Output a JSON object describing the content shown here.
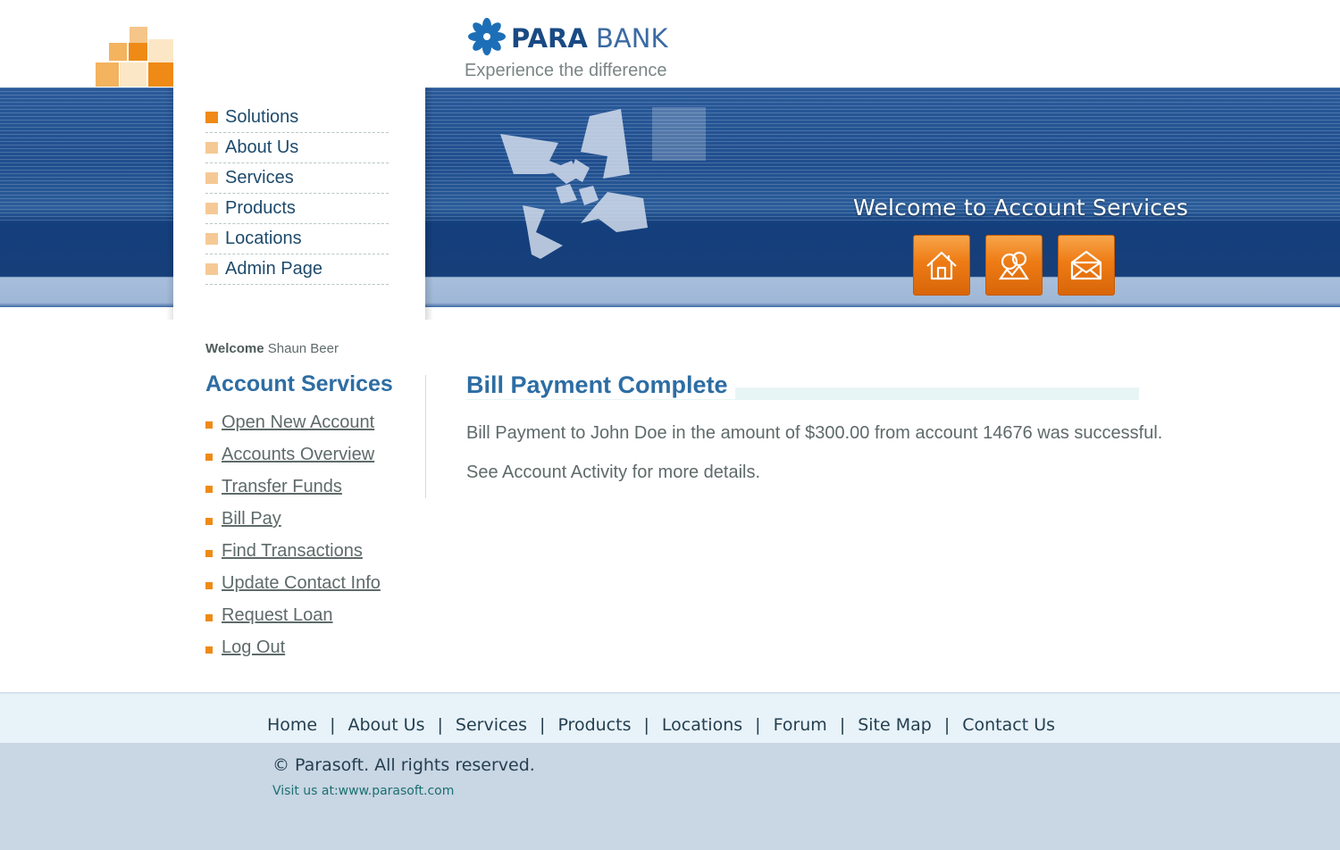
{
  "brand": {
    "name_bold": "PARA",
    "name_light": "BANK",
    "tagline": "Experience the difference"
  },
  "top_menu": [
    {
      "label": "Solutions",
      "active": true
    },
    {
      "label": "About Us"
    },
    {
      "label": "Services"
    },
    {
      "label": "Products"
    },
    {
      "label": "Locations"
    },
    {
      "label": "Admin Page"
    }
  ],
  "header": {
    "banner": "Welcome to Account Services",
    "buttons": [
      {
        "icon": "home-icon"
      },
      {
        "icon": "contact-people-icon"
      },
      {
        "icon": "envelope-icon"
      }
    ]
  },
  "account_panel": {
    "welcome_label": "Welcome",
    "user_name": "Shaun Beer",
    "title": "Account Services",
    "links": [
      "Open New Account",
      "Accounts Overview",
      "Transfer Funds",
      "Bill Pay",
      "Find Transactions",
      "Update Contact Info",
      "Request Loan",
      "Log Out"
    ]
  },
  "main": {
    "title": "Bill Payment Complete",
    "message": "Bill Payment to John Doe in the amount of $300.00 from account 14676 was successful.",
    "note": "See Account Activity for more details."
  },
  "footer": {
    "nav": [
      "Home",
      "About Us",
      "Services",
      "Products",
      "Locations",
      "Forum",
      "Site Map",
      "Contact Us"
    ],
    "separator": "|",
    "copyright": "© Parasoft. All rights reserved.",
    "visit": "Visit us at:www.parasoft.com"
  },
  "colors": {
    "header_blue": "#1f4e8e",
    "accent_orange": "#ef8a16",
    "title_blue": "#2d6da3",
    "footer_bg": "#c9d6e4"
  }
}
